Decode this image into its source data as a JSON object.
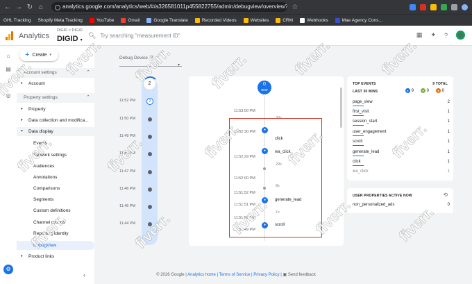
{
  "browser": {
    "url": "analytics.google.com/analytics/web/#/a326581011p455822755/admin/debugview/overview?para...",
    "bookmarks": [
      "GHL Tracking",
      "Shopify Meta Tracking",
      "YouTube",
      "Gmail",
      "Google Translate",
      "Recorded Videos",
      "Websites",
      "CRM",
      "Webhooks",
      "Mae Agency Cons..."
    ]
  },
  "header": {
    "brand": "Analytics",
    "breadcrumb": "DIGID > DIGID",
    "property": "DIGID",
    "search_placeholder": "Try searching \"measurement ID\""
  },
  "sidebar": {
    "create_label": "Create",
    "account_settings": "Account settings",
    "account": "Account",
    "property_settings": "Property settings",
    "property": "Property",
    "data_collection": "Data collection and modifica...",
    "data_display": "Data display",
    "sub_items": [
      "Events",
      "Network settings",
      "Audiences",
      "Annotations",
      "Comparisons",
      "Segments",
      "Custom definitions",
      "Channel groups",
      "Reporting identity",
      "DebugView"
    ],
    "product_links": "Product links"
  },
  "debug": {
    "device_label": "Debug Device",
    "device_count": "0",
    "minutes_top": "2",
    "minute_rows": [
      {
        "time": "11:52 PM",
        "count": "2"
      },
      {
        "time": "11:50 PM",
        "count": ""
      },
      {
        "time": "11:49 PM",
        "count": ""
      },
      {
        "time": "11:48 PM",
        "count": ""
      },
      {
        "time": "11:47 PM",
        "count": ""
      },
      {
        "time": "11:46 PM",
        "count": ""
      },
      {
        "time": "11:45 PM",
        "count": ""
      },
      {
        "time": "11:44 PM",
        "count": ""
      }
    ],
    "new_count": "0",
    "new_label": "new",
    "seconds": [
      {
        "time": "11:53:00 PM",
        "gap": "30s",
        "event": ""
      },
      {
        "time": "11:52:30 PM",
        "gap": "",
        "event": "click"
      },
      {
        "time": "11:52:29 PM",
        "gap": "",
        "event": "wa_click"
      },
      {
        "time": "",
        "gap": "29s",
        "event": ""
      },
      {
        "time": "11:52:00 PM",
        "gap": "",
        "event": ""
      },
      {
        "time": "",
        "gap": "8s",
        "event": ""
      },
      {
        "time": "11:51:52 PM",
        "gap": "",
        "event": ""
      },
      {
        "time": "11:51:51 PM",
        "gap": "",
        "event": "generate_lead"
      },
      {
        "time": "",
        "gap": "1s",
        "event": ""
      },
      {
        "time": "11:51:50 PM",
        "gap": "",
        "event": ""
      },
      {
        "time": "11:51:49 PM",
        "gap": "",
        "event": "scroll"
      }
    ]
  },
  "top_events": {
    "title": "TOP EVENTS",
    "total": "9 TOTAL",
    "period": "LAST 30 MINS",
    "counts": [
      "9",
      "0",
      "0"
    ],
    "colors": [
      "#1a73e8",
      "#7cb342",
      "#e8710a"
    ],
    "events": [
      {
        "name": "page_view",
        "count": "2"
      },
      {
        "name": "first_visit",
        "count": "1"
      },
      {
        "name": "session_start",
        "count": "1"
      },
      {
        "name": "user_engagement",
        "count": "1"
      },
      {
        "name": "scroll",
        "count": "1"
      },
      {
        "name": "generate_lead",
        "count": "1"
      },
      {
        "name": "click",
        "count": "1"
      },
      {
        "name": "wa_click",
        "count": "1"
      }
    ]
  },
  "user_properties": {
    "title": "USER PROPERTIES ACTIVE NOW",
    "items": [
      {
        "name": "non_personalized_ads",
        "value": "0"
      }
    ]
  },
  "footer": {
    "copyright": "© 2026 Google |",
    "analytics_home": "Analytics home",
    "tos": "Terms of Service",
    "privacy": "Privacy Policy",
    "feedback": "Send feedback"
  },
  "watermark": "fiverr."
}
